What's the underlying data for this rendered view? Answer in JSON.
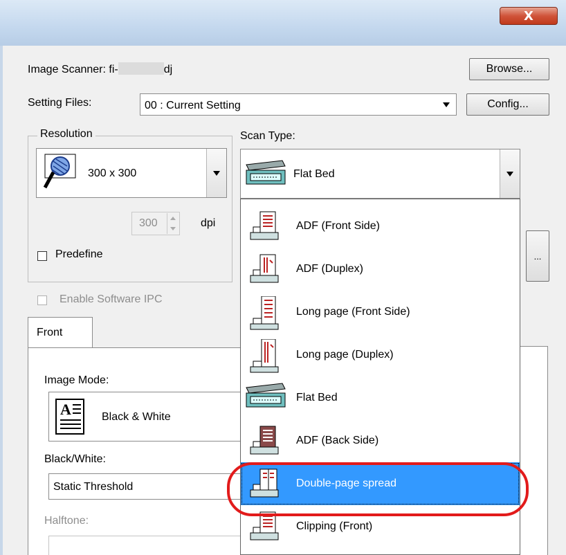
{
  "window": {
    "close_label": "X"
  },
  "scanner": {
    "label_prefix": "Image Scanner: fi-",
    "label_suffix": "dj",
    "browse_label": "Browse..."
  },
  "setting_files": {
    "label": "Setting Files:",
    "value": "00 : Current Setting",
    "config_label": "Config..."
  },
  "resolution": {
    "legend": "Resolution",
    "value": "300 x 300",
    "dpi_value": "300",
    "dpi_unit": "dpi",
    "predefine_label": "Predefine",
    "predefine_checked": false
  },
  "scan_type": {
    "label": "Scan Type:",
    "value": "Flat Bed",
    "more_label": "...",
    "options": [
      {
        "label": "ADF (Front Side)",
        "icon": "adf-front-icon"
      },
      {
        "label": "ADF (Duplex)",
        "icon": "adf-duplex-icon"
      },
      {
        "label": "Long page (Front Side)",
        "icon": "long-page-front-icon"
      },
      {
        "label": "Long page (Duplex)",
        "icon": "long-page-duplex-icon"
      },
      {
        "label": "Flat Bed",
        "icon": "flatbed-icon"
      },
      {
        "label": "ADF (Back Side)",
        "icon": "adf-back-icon"
      },
      {
        "label": "Double-page spread",
        "icon": "double-page-spread-icon",
        "selected": true
      },
      {
        "label": "Clipping (Front)",
        "icon": "clipping-front-icon"
      }
    ]
  },
  "software_ipc": {
    "label": "Enable Software IPC",
    "enabled": false
  },
  "tabs": {
    "front": "Front"
  },
  "image_mode": {
    "label": "Image Mode:",
    "value": "Black & White"
  },
  "black_white": {
    "label": "Black/White:",
    "value": "Static Threshold"
  },
  "halftone": {
    "label": "Halftone:"
  },
  "colors": {
    "selection": "#3399ff",
    "highlight": "#e21b1b",
    "dialog_bg": "#f0f0f0"
  }
}
